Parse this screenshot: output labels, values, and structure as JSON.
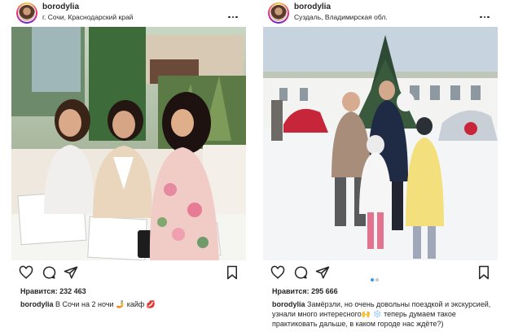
{
  "posts": [
    {
      "username": "borodylia",
      "location": "г. Сочи, Краснодарский край",
      "likes_label": "Нравится:",
      "likes_count": "232 463",
      "caption_user": "borodylia",
      "caption_text": "В Сочи на 2 ночи 🤳 кайф 💋"
    },
    {
      "username": "borodylia",
      "location": "Суздаль, Владимирская обл.",
      "likes_label": "Нравится:",
      "likes_count": "295 666",
      "caption_user": "borodylia",
      "caption_text": "Замёрзли, но очень довольны поездкой и экскурсией, узнали много интересного🙌 ❄️ теперь думаем такое практиковать дальше, в каком  городе нас ждёте?)"
    }
  ],
  "icons": [
    "heart-icon",
    "comment-icon",
    "share-icon",
    "bookmark-icon",
    "more-options-icon"
  ],
  "colors": {
    "text": "#262626",
    "accent_dot": "#3897f0",
    "inactive_dot": "#c7c7c7"
  },
  "carousel": {
    "active_index": 0,
    "count": 2
  }
}
